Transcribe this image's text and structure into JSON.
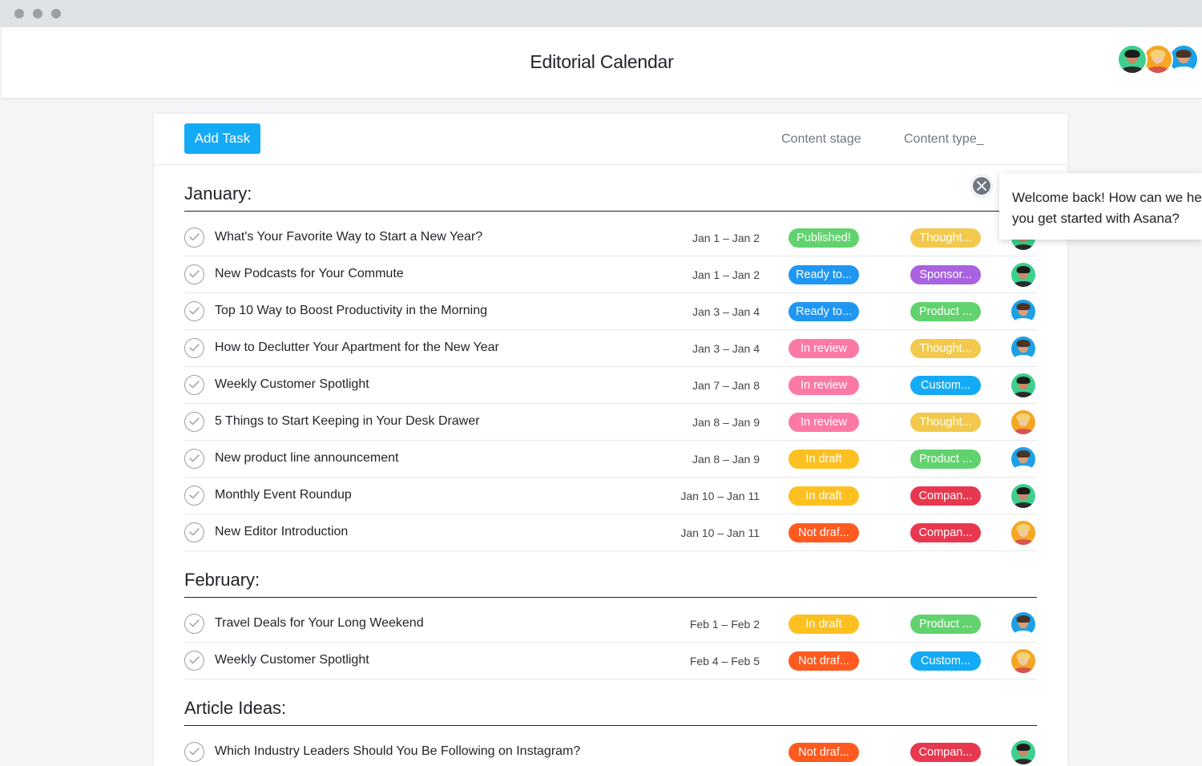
{
  "header": {
    "title": "Editorial Calendar"
  },
  "toolbar": {
    "add_task_label": "Add Task",
    "columns": {
      "stage": "Content stage",
      "type": "Content type_"
    }
  },
  "tooltip": {
    "line1": "Welcome back! How can we help",
    "line2": "you get started with Asana?"
  },
  "colors": {
    "accent": "#14aaf5",
    "published": "#62d26f",
    "ready": "#1e96f2",
    "in_review": "#fc79a5",
    "in_draft": "#fdc021",
    "not_drafted": "#ff5a1f",
    "thought": "#f2c94c",
    "sponsor": "#a962e0",
    "product": "#62d26f",
    "customer": "#14aaf5",
    "company": "#e8384f"
  },
  "sections": [
    {
      "title": "January:",
      "tasks": [
        {
          "name": "What's Your Favorite Way to Start a New Year?",
          "date": "Jan 1 – Jan 2",
          "stage": "Published!",
          "stage_color": "#62d26f",
          "type": "Thought...",
          "type_color": "#f2c94c",
          "avatar": "woman-dark-icon"
        },
        {
          "name": "New Podcasts for Your Commute",
          "date": "Jan 1 – Jan 2",
          "stage": "Ready to...",
          "stage_color": "#1e96f2",
          "type": "Sponsor...",
          "type_color": "#a962e0",
          "avatar": "woman-dark-icon"
        },
        {
          "name": "Top 10 Way to Boost Productivity in the Morning",
          "date": "Jan 3 – Jan 4",
          "stage": "Ready to...",
          "stage_color": "#1e96f2",
          "type": "Product ...",
          "type_color": "#62d26f",
          "avatar": "man-blue-icon"
        },
        {
          "name": "How to Declutter Your Apartment for the New Year",
          "date": "Jan 3 – Jan 4",
          "stage": "In review",
          "stage_color": "#fc79a5",
          "type": "Thought...",
          "type_color": "#f2c94c",
          "avatar": "man-blue-icon"
        },
        {
          "name": "Weekly Customer Spotlight",
          "date": "Jan 7 – Jan 8",
          "stage": "In review",
          "stage_color": "#fc79a5",
          "type": "Custom...",
          "type_color": "#14aaf5",
          "avatar": "woman-dark-icon"
        },
        {
          "name": "5 Things to Start Keeping in Your Desk Drawer",
          "date": "Jan 8 – Jan 9",
          "stage": "In review",
          "stage_color": "#fc79a5",
          "type": "Thought...",
          "type_color": "#f2c94c",
          "avatar": "woman-blonde-icon"
        },
        {
          "name": "New product line announcement",
          "date": "Jan 8 – Jan 9",
          "stage": "In draft",
          "stage_color": "#fdc021",
          "type": "Product ...",
          "type_color": "#62d26f",
          "avatar": "man-blue-icon"
        },
        {
          "name": "Monthly Event Roundup",
          "date": "Jan 10 – Jan 11",
          "stage": "In draft",
          "stage_color": "#fdc021",
          "type": "Compan...",
          "type_color": "#e8384f",
          "avatar": "woman-dark-icon"
        },
        {
          "name": "New Editor Introduction",
          "date": "Jan 10 – Jan 11",
          "stage": "Not draf...",
          "stage_color": "#ff5a1f",
          "type": "Compan...",
          "type_color": "#e8384f",
          "avatar": "woman-blonde-icon"
        }
      ]
    },
    {
      "title": "February:",
      "tasks": [
        {
          "name": "Travel Deals for Your Long Weekend",
          "date": "Feb 1 – Feb 2",
          "stage": "In draft",
          "stage_color": "#fdc021",
          "type": "Product ...",
          "type_color": "#62d26f",
          "avatar": "man-blue-icon"
        },
        {
          "name": "Weekly Customer Spotlight",
          "date": "Feb 4 – Feb 5",
          "stage": "Not draf...",
          "stage_color": "#ff5a1f",
          "type": "Custom...",
          "type_color": "#14aaf5",
          "avatar": "woman-blonde-icon"
        }
      ]
    },
    {
      "title": "Article Ideas:",
      "tasks": [
        {
          "name": "Which Industry Leaders Should You Be Following on Instagram?",
          "date": "",
          "stage": "Not draf...",
          "stage_color": "#ff5a1f",
          "type": "Compan...",
          "type_color": "#e8384f",
          "avatar": "woman-dark-icon"
        }
      ]
    }
  ],
  "header_avatars": [
    "woman-dark-icon",
    "woman-blonde-icon",
    "man-blue-icon"
  ]
}
